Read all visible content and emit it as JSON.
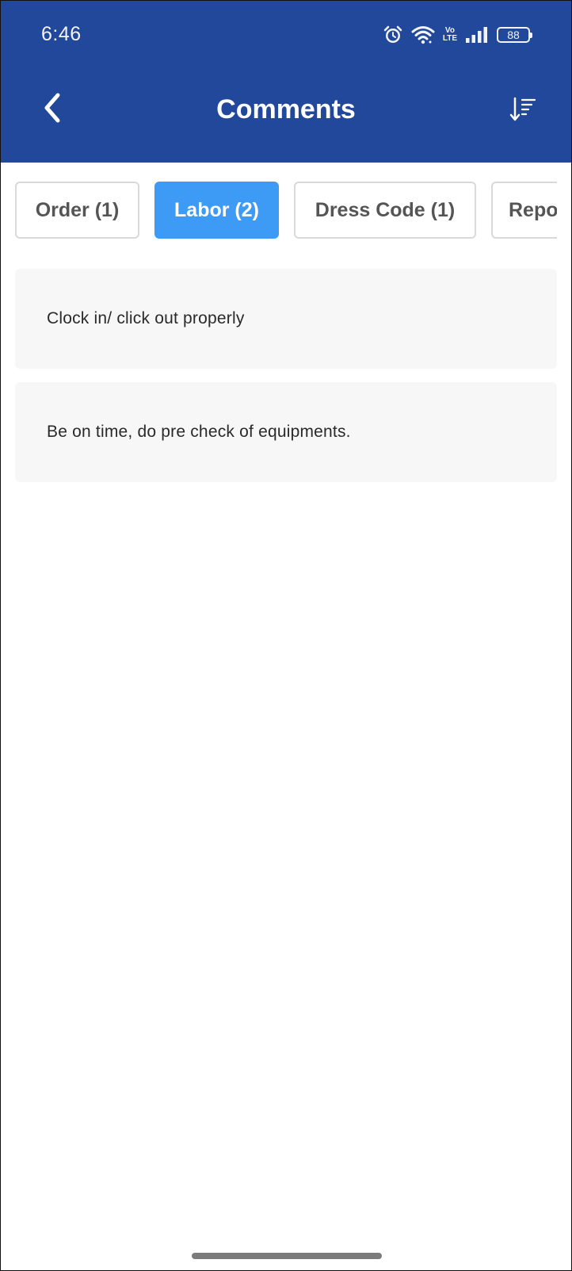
{
  "status_bar": {
    "time": "6:46",
    "volte_top": "Vo",
    "volte_bottom": "LTE",
    "battery": "88",
    "icons": [
      "alarm-icon",
      "wifi-icon",
      "volte-icon",
      "signal-icon",
      "battery-icon"
    ]
  },
  "header": {
    "title": "Comments",
    "back_icon": "chevron-left-icon",
    "sort_icon": "sort-descending-icon",
    "background": "#22489c"
  },
  "tabs": [
    {
      "label": "Order (1)",
      "active": false
    },
    {
      "label": "Labor (2)",
      "active": true
    },
    {
      "label": "Dress Code (1)",
      "active": false
    },
    {
      "label": "Repo",
      "active": false
    }
  ],
  "active_tab_color": "#3d9bf5",
  "comments": [
    {
      "text": "Clock in/ click out properly"
    },
    {
      "text": "Be on time, do pre check of equipments."
    }
  ]
}
